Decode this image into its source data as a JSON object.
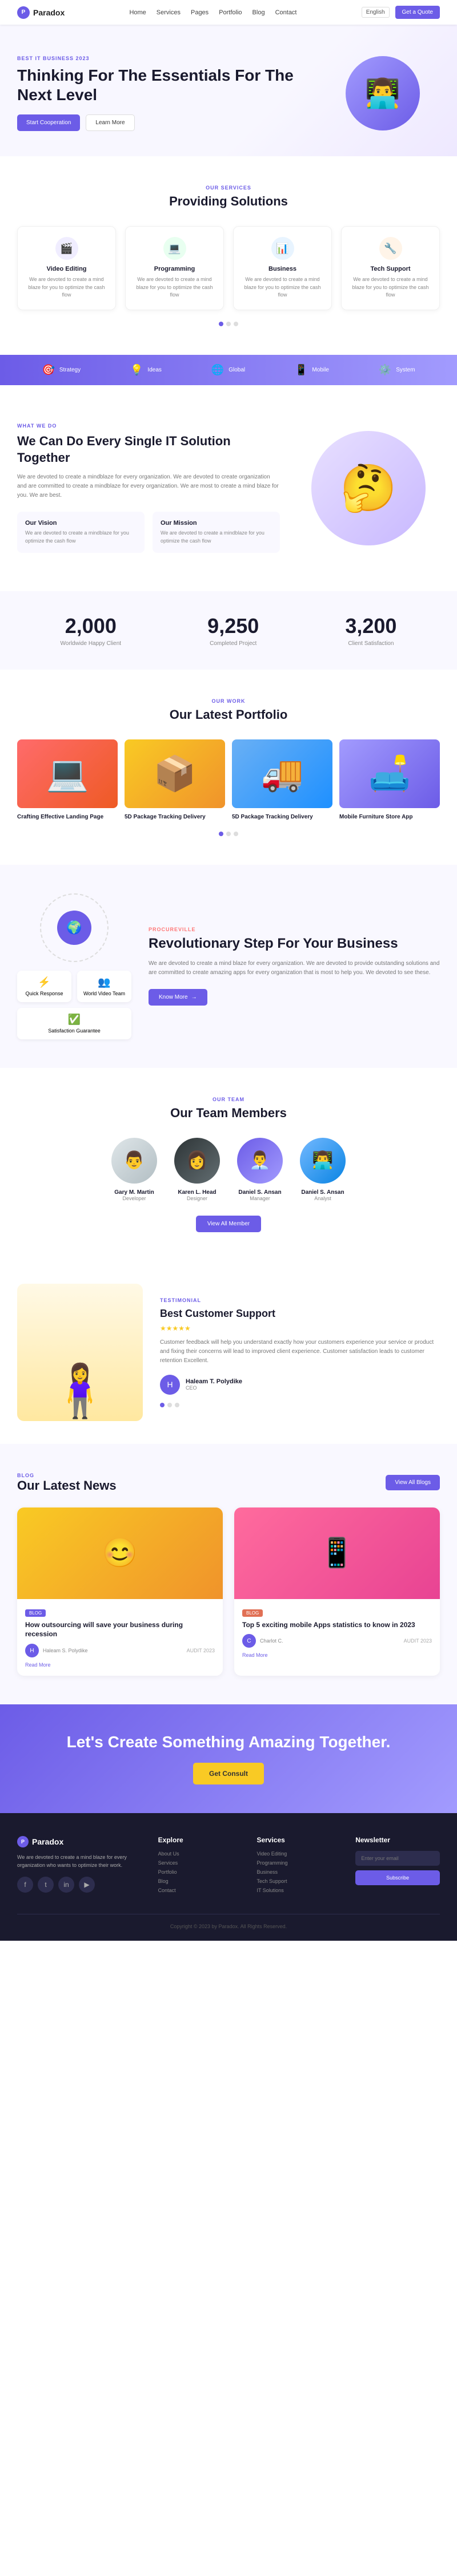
{
  "brand": {
    "name": "Paradox",
    "logo_icon": "P"
  },
  "nav": {
    "links": [
      "Home",
      "Services",
      "Pages",
      "Portfolio",
      "Blog",
      "Contact"
    ],
    "lang": "English",
    "cta": "Get a Quote"
  },
  "hero": {
    "badge": "Best IT Business 2023",
    "title": "Thinking For The Essentials For The Next Level",
    "btn_primary": "Start Cooperation",
    "btn_secondary": "Learn More"
  },
  "solutions": {
    "label": "Our Services",
    "title": "Providing Solutions",
    "cards": [
      {
        "icon": "🎬",
        "color": "purple",
        "title": "Video Editing",
        "desc": "We are devoted to create a mind blaze for you to optimize the cash flow"
      },
      {
        "icon": "💻",
        "color": "green",
        "title": "Programming",
        "desc": "We are devoted to create a mind blaze for you to optimize the cash flow"
      },
      {
        "icon": "📊",
        "color": "blue",
        "title": "Business",
        "desc": "We are devoted to create a mind blaze for you to optimize the cash flow"
      },
      {
        "icon": "🔧",
        "color": "orange",
        "title": "Tech Support",
        "desc": "We are devoted to create a mind blaze for you to optimize the cash flow"
      }
    ]
  },
  "services_bar": {
    "items": [
      {
        "icon": "🎯",
        "label": "Strategy"
      },
      {
        "icon": "💡",
        "label": "Ideas"
      },
      {
        "icon": "🌐",
        "label": "Global"
      },
      {
        "icon": "📱",
        "label": "Mobile"
      },
      {
        "icon": "⚙️",
        "label": "System"
      }
    ]
  },
  "it_section": {
    "label": "What We Do",
    "title": "We Can Do Every Single IT Solution Together",
    "desc": "We are devoted to create a mindblaze for every organization. We are devoted to create organization and are committed to create a mindblaze for every organization. We are most to create a mind blaze for you. We are best.",
    "boxes": [
      {
        "title": "Our Vision",
        "desc": "We are devoted to create a mindblaze for you optimize the cash flow"
      },
      {
        "title": "Our Mission",
        "desc": "We are devoted to create a mindblaze for you optimize the cash flow"
      }
    ]
  },
  "stats": [
    {
      "number": "2,000",
      "label": "Worldwide Happy Client"
    },
    {
      "number": "9,250",
      "label": "Completed Project"
    },
    {
      "number": "3,200",
      "label": "Client Satisfaction"
    }
  ],
  "portfolio": {
    "label": "Our Work",
    "title": "Our Latest Portfolio",
    "items": [
      {
        "color": "1",
        "title": "Crafting Effective Landing Page"
      },
      {
        "color": "2",
        "title": "5D Package Tracking Delivery"
      },
      {
        "color": "3",
        "title": "5D Package Tracking Delivery"
      },
      {
        "color": "4",
        "title": "Mobile Furniture Store App"
      }
    ]
  },
  "revolutionary": {
    "label": "PROCUREVILLE",
    "title": "Revolutionary Step For Your Business",
    "desc": "We are devoted to create a mind blaze for every organization. We are devoted to provide outstanding solutions and are committed to create amazing apps for every organization that is most to help you. We devoted to see these.",
    "btn": "Know More",
    "diagram": {
      "center_icon": "🌍",
      "items": [
        {
          "icon": "⚡",
          "label": "Quick Response"
        },
        {
          "icon": "✅",
          "label": "Satisfaction Guarantee"
        },
        {
          "icon": "👥",
          "label": "World Video Team"
        }
      ]
    }
  },
  "team": {
    "label": "Our Team",
    "title": "Our Team Members",
    "members": [
      {
        "name": "Gary M. Martin",
        "role": "Developer",
        "avatar": "👨"
      },
      {
        "name": "Karen L. Head",
        "role": "Designer",
        "avatar": "👩"
      },
      {
        "name": "Daniel S. Ansan",
        "role": "Manager",
        "avatar": "👨‍💼"
      },
      {
        "name": "Daniel S. Ansan",
        "role": "Analyst",
        "avatar": "👨‍💻"
      }
    ],
    "view_all": "View All Member"
  },
  "testimonial": {
    "label": "TESTIMONIAL",
    "title": "Best Customer Support",
    "stars": "★★★★★",
    "desc": "Customer feedback will help you understand exactly how your customers experience your service or product and fixing their concerns will lead to improved client experience. Customer satisfaction leads to customer retention Excellent.",
    "author": {
      "name": "Haleam T. Polydike",
      "role": "CEO",
      "avatar": "H"
    }
  },
  "news": {
    "label": "BLOG",
    "title": "Our Latest News",
    "view_all": "View All Blogs",
    "items": [
      {
        "tag": "BLOG",
        "tag_color": "tech",
        "date": "AUDIT 2023",
        "title": "How outsourcing will save your business during recession",
        "author": "Haleam S. Polydike",
        "author_avatar": "H",
        "read_more": "Read More",
        "image_type": "1"
      },
      {
        "tag": "BLOG",
        "tag_color": "app",
        "date": "AUDIT 2023",
        "title": "Top 5 exciting mobile Apps statistics to know in 2023",
        "author": "Charlot C.",
        "author_avatar": "C",
        "read_more": "Read More",
        "image_type": "2"
      }
    ]
  },
  "cta": {
    "title": "Let's Create Something Amazing Together.",
    "btn": "Get Consult"
  },
  "footer": {
    "brand_desc": "We are devoted to create a mind blaze for every organization who wants to optimize their work.",
    "social": [
      "f",
      "t",
      "in",
      "yt"
    ],
    "columns": [
      {
        "title": "Explore",
        "links": [
          "About Us",
          "Services",
          "Portfolio",
          "Blog",
          "Contact"
        ]
      },
      {
        "title": "Services",
        "links": [
          "Video Editing",
          "Programming",
          "Business",
          "Tech Support",
          "IT Solutions"
        ]
      },
      {
        "title": "Newsletter",
        "is_newsletter": true,
        "placeholder": "Enter your email",
        "btn": "Subscribe"
      }
    ],
    "copyright": "Copyright © 2023 by Paradox. All Rights Reserved."
  }
}
